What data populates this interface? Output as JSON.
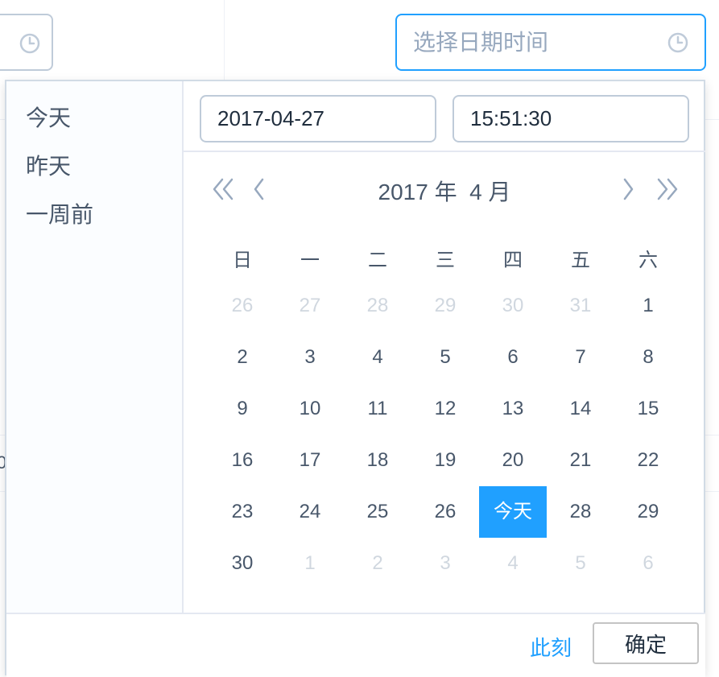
{
  "background": {
    "stray_text": "0"
  },
  "top_input": {
    "placeholder": "选择日期时间",
    "icon": "clock-icon"
  },
  "picker": {
    "shortcuts": [
      "今天",
      "昨天",
      "一周前"
    ],
    "date_value": "2017-04-27",
    "time_value": "15:51:30",
    "header": {
      "year_label": "2017 年",
      "month_label": "4 月",
      "prev_year_icon": "double-chevron-left-icon",
      "prev_month_icon": "chevron-left-icon",
      "next_month_icon": "chevron-right-icon",
      "next_year_icon": "double-chevron-right-icon"
    },
    "weekdays": [
      "日",
      "一",
      "二",
      "三",
      "四",
      "五",
      "六"
    ],
    "weeks": [
      [
        {
          "t": "26",
          "o": true
        },
        {
          "t": "27",
          "o": true
        },
        {
          "t": "28",
          "o": true
        },
        {
          "t": "29",
          "o": true
        },
        {
          "t": "30",
          "o": true
        },
        {
          "t": "31",
          "o": true
        },
        {
          "t": "1"
        }
      ],
      [
        {
          "t": "2"
        },
        {
          "t": "3"
        },
        {
          "t": "4"
        },
        {
          "t": "5"
        },
        {
          "t": "6"
        },
        {
          "t": "7"
        },
        {
          "t": "8"
        }
      ],
      [
        {
          "t": "9"
        },
        {
          "t": "10"
        },
        {
          "t": "11"
        },
        {
          "t": "12"
        },
        {
          "t": "13"
        },
        {
          "t": "14"
        },
        {
          "t": "15"
        }
      ],
      [
        {
          "t": "16"
        },
        {
          "t": "17"
        },
        {
          "t": "18"
        },
        {
          "t": "19"
        },
        {
          "t": "20"
        },
        {
          "t": "21"
        },
        {
          "t": "22"
        }
      ],
      [
        {
          "t": "23"
        },
        {
          "t": "24"
        },
        {
          "t": "25"
        },
        {
          "t": "26"
        },
        {
          "t": "今天",
          "today": true
        },
        {
          "t": "28"
        },
        {
          "t": "29"
        }
      ],
      [
        {
          "t": "30"
        },
        {
          "t": "1",
          "o": true
        },
        {
          "t": "2",
          "o": true
        },
        {
          "t": "3",
          "o": true
        },
        {
          "t": "4",
          "o": true
        },
        {
          "t": "5",
          "o": true
        },
        {
          "t": "6",
          "o": true
        }
      ]
    ],
    "footer": {
      "now_label": "此刻",
      "confirm_label": "确定"
    }
  },
  "colors": {
    "accent": "#20a0ff",
    "text": "#48576a",
    "muted": "#97a8be",
    "disabled": "#d0d7df",
    "border": "#bfcbd9"
  }
}
